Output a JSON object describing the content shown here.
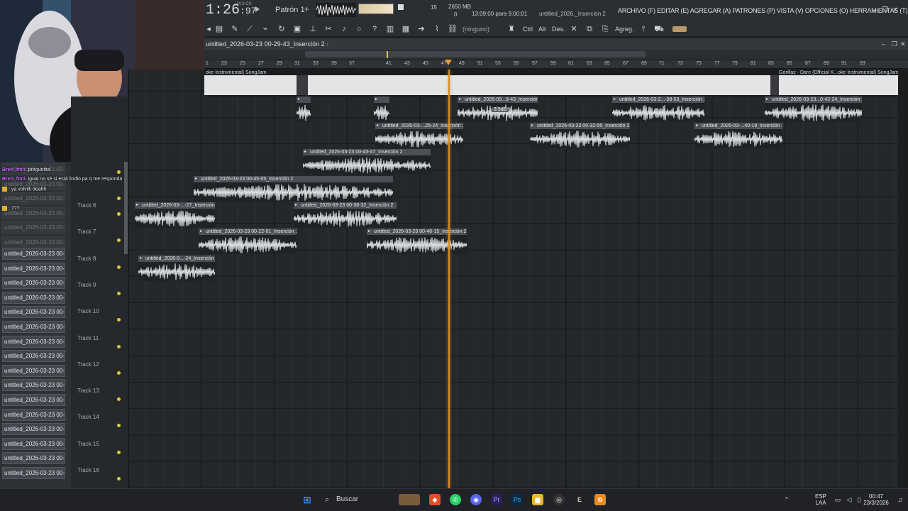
{
  "transport": {
    "time_main": "1:26",
    "time_frac": ":97",
    "time_mode": "M:S:CS",
    "pattern": "Patrón 1",
    "cpu": "15",
    "memory": "2650 MB",
    "memory_sub": "0",
    "hint": "13:09:00 para 9:00:01",
    "project_title": "untitled_2026._Inserción 2"
  },
  "menu": {
    "text": "ARCHIVO (F) EDITAR (E) AGREGAR (A) PATRONES (P) VISTA (V) OPCIONES (O) HERRAMIENTAS (T) AYUDA"
  },
  "toolbar": {
    "snap": "(ninguno)",
    "ctrl": "Ctrl",
    "alt": "Alt",
    "des": "Des.",
    "agreg": "Agreg."
  },
  "playlist": {
    "title": "untitled_2026-03-23 00-29-43_Inserción 2",
    "song_left": "oke Instrumental)  SongJam",
    "song_right": "Gorillaz - Dare (Official K...oke Instrumental)  SongJam",
    "ruler": [
      "1",
      "23",
      "25",
      "27",
      "29",
      "31",
      "33",
      "35",
      "37",
      "41",
      "43",
      "45",
      "47",
      "49",
      "51",
      "53",
      "55",
      "57",
      "59",
      "61",
      "63",
      "65",
      "67",
      "69",
      "71",
      "73",
      "75",
      "77",
      "79",
      "81",
      "83",
      "85",
      "87",
      "89",
      "91",
      "93"
    ],
    "tracks": [
      "Track 6",
      "Track 7",
      "Track 8",
      "Track 9",
      "Track 10",
      "Track 11",
      "Track 12",
      "Track 13",
      "Track 14",
      "Track 15",
      "Track 16"
    ],
    "clips": [
      {
        "label": "",
        "row": 0
      },
      {
        "label": "",
        "row": 0
      },
      {
        "label": "untitled_2026-03...9-43_Inserción 2",
        "row": 0,
        "badge": "3.5dB"
      },
      {
        "label": "untitled_2026-03-2...-38-53_Inserción 2",
        "row": 0
      },
      {
        "label": "untitled_2026-03-23...0-42-24_Inserción 2",
        "row": 0
      },
      {
        "label": "untitled_2026-03-...25-24_Inserción 2",
        "row": 1
      },
      {
        "label": "untitled_2026-03-23 00-32-55_Inserción 2",
        "row": 1
      },
      {
        "label": "untitled_2026-03-...40-19_Inserción 2",
        "row": 1
      },
      {
        "label": "untitled_2026-03-23 00-43-47_Inserción 2",
        "row": 2
      },
      {
        "label": "untitled_2026-03-23 00-45-05_Inserción 2",
        "row": 3
      },
      {
        "label": "untitled_2026-03-...-27_Inserción 2",
        "row": 4
      },
      {
        "label": "untitled_2026-03-23 00-38-32_Inserción 2",
        "row": 4
      },
      {
        "label": "untitled_2026-03-23 00-22-01_Inserción 2",
        "row": 5
      },
      {
        "label": "untitled_2026-03-23 00-46-15_Inserción 2",
        "row": 5
      },
      {
        "label": "untitled_2026-0...-24_Inserción 2",
        "row": 6
      }
    ]
  },
  "browser": {
    "item": "untitled_2026-03-23 00-..."
  },
  "chat": [
    {
      "user": "Bren_fmti",
      "msg": ": preguntita"
    },
    {
      "user": "Bren_fmti",
      "msg": ": igual no sé si está lindio pa q me responda"
    },
    {
      "user": "",
      "msg": ": ya volvilli deahh"
    },
    {
      "user": "",
      "msg": ": ???"
    }
  ],
  "taskbar": {
    "search": "Buscar",
    "lang_top": "ESP",
    "lang_bottom": "LAA",
    "time": "00:47",
    "date": "23/3/2026"
  }
}
